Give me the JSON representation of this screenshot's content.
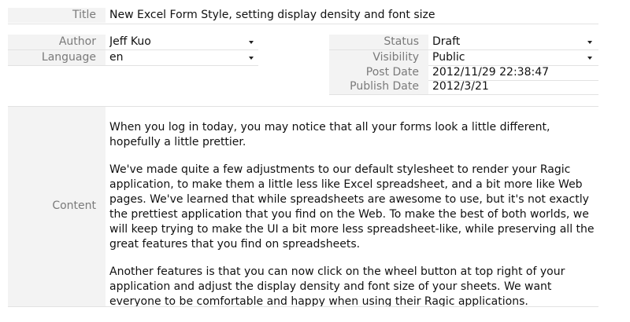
{
  "form": {
    "title": {
      "label": "Title",
      "value": "New Excel Form Style, setting display density and font size"
    },
    "author": {
      "label": "Author",
      "value": "Jeff Kuo"
    },
    "language": {
      "label": "Language",
      "value": "en"
    },
    "status": {
      "label": "Status",
      "value": "Draft"
    },
    "visibility": {
      "label": "Visibility",
      "value": "Public"
    },
    "post_date": {
      "label": "Post Date",
      "value": "2012/11/29 22:38:47"
    },
    "publish_date": {
      "label": "Publish Date",
      "value": "2012/3/21"
    },
    "content": {
      "label": "Content",
      "paragraphs": [
        "When you log in today, you may notice that all your forms look a little different, hopefully a little prettier.",
        "We've made quite a few adjustments to our default stylesheet to render your Ragic application, to make them a little less like Excel spreadsheet, and a bit more like Web pages. We've learned that while spreadsheets are awesome to use, but it's not exactly the prettiest application that you find on the Web. To make the best of both worlds, we will keep trying to make the UI a bit more less spreadsheet-like, while preserving all the great features that you find on spreadsheets.",
        "Another features is that you can now click on the wheel button at top right of your application and adjust the display density and font size of your sheets. We want  everyone to be comfortable and happy when using their Ragic applications."
      ]
    }
  },
  "icons": {
    "dropdown": "caret-down-icon"
  }
}
